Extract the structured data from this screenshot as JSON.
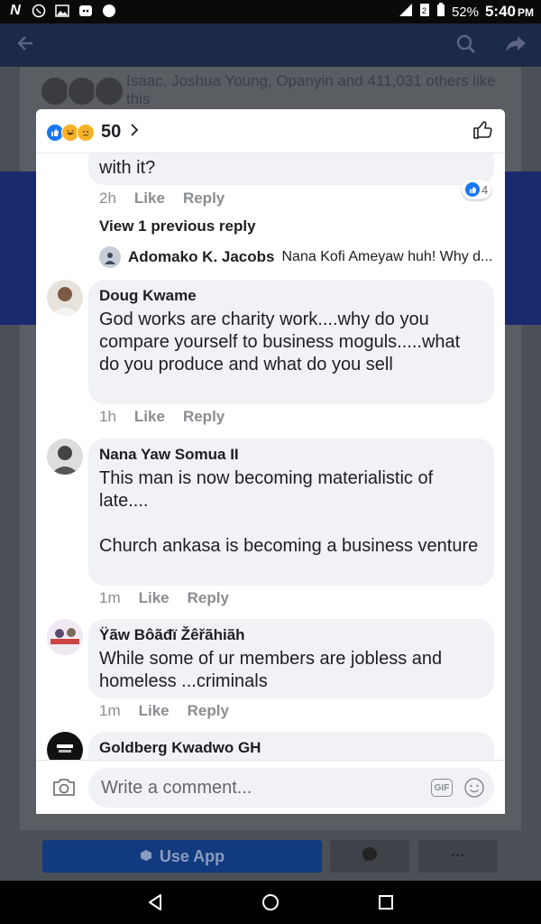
{
  "status_bar": {
    "battery": "52%",
    "time": "5:40",
    "ampm": "PM"
  },
  "background": {
    "likes_text": "Isaac, Joshua Young, Opanyin and 411,031 others like this",
    "use_app_label": "Use App",
    "more_label": "···"
  },
  "modal": {
    "reaction_count": "50",
    "reaction_icons": [
      "like-icon",
      "haha-icon",
      "sad-icon"
    ],
    "top_cut": {
      "text": "with it?",
      "time": "2h",
      "like": "Like",
      "reply": "Reply",
      "reaction_badge_count": "4"
    },
    "view_previous": "View 1 previous reply",
    "reply_preview": {
      "name": "Adomako K. Jacobs",
      "text": "Nana Kofi Ameyaw huh! Why d..."
    },
    "comments": [
      {
        "name": "Doug Kwame",
        "text": "God works are charity work....why do you compare yourself to business moguls.....what do you produce and what do you sell",
        "time": "1h",
        "like": "Like",
        "reply": "Reply"
      },
      {
        "name": "Nana Yaw Somua II",
        "text": "This man is now becoming materialistic of late....\n\nChurch ankasa is becoming a business venture",
        "time": "1m",
        "like": "Like",
        "reply": "Reply"
      },
      {
        "name": "Ÿãw Bôãđï Žêřãhiãh",
        "text": "While some of ur members are jobless and homeless ...criminals",
        "time": "1m",
        "like": "Like",
        "reply": "Reply"
      },
      {
        "name": "Goldberg Kwadwo GH",
        "text": "",
        "time": "",
        "like": "",
        "reply": ""
      }
    ],
    "composer": {
      "placeholder": "Write a comment...",
      "gif_label": "GIF"
    }
  },
  "colors": {
    "fb_blue": "#1877f2",
    "bubble": "#f0f2f5",
    "meta_gray": "#8a8d91"
  }
}
